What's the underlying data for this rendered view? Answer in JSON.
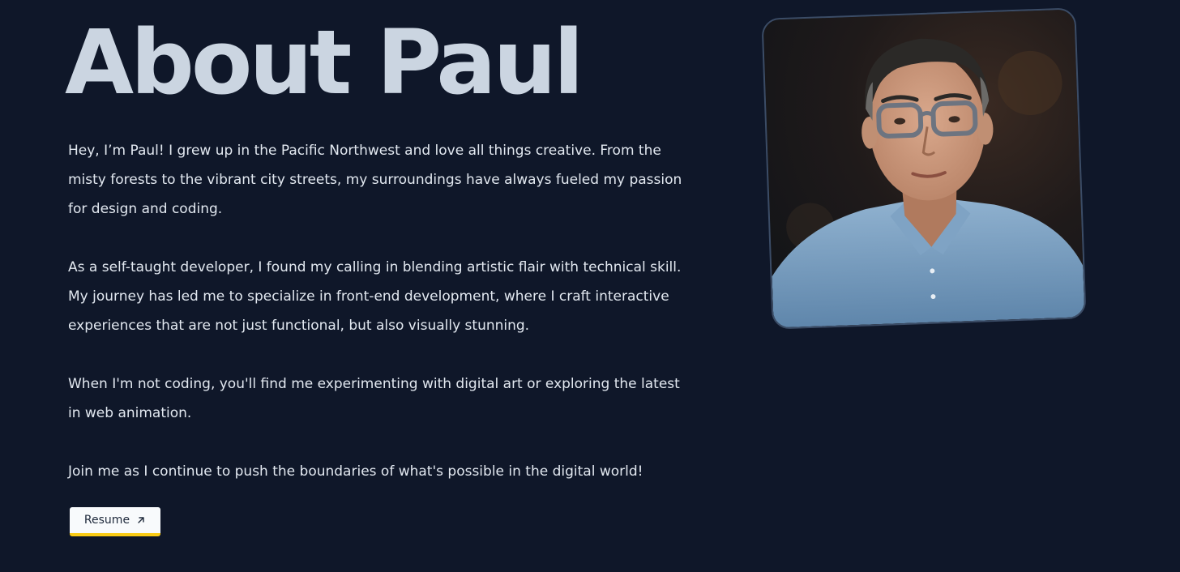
{
  "about": {
    "heading": "About Paul",
    "paragraphs": [
      "Hey, I’m Paul! I grew up in the Pacific Northwest and love all things creative. From the misty forests to the vibrant city streets, my surroundings have always fueled my passion for design and coding.",
      "As a self-taught developer, I found my calling in blending artistic flair with technical skill. My journey has led me to specialize in front-end development, where I craft interactive experiences that are not just functional, but also visually stunning.",
      "When I'm not coding, you'll find me experimenting with digital art or exploring the latest in web animation.",
      "Join me as I continue to push the boundaries of what's possible in the digital world!"
    ],
    "resume_button": {
      "label": "Resume",
      "icon": "arrow-up-right-icon"
    },
    "portrait": {
      "alt": "portrait-photo"
    }
  },
  "colors": {
    "background": "#0f1729",
    "heading": "#cbd5e1",
    "body_text": "#e2e8f0",
    "button_bg": "#f8fafc",
    "button_accent": "#facc15"
  }
}
